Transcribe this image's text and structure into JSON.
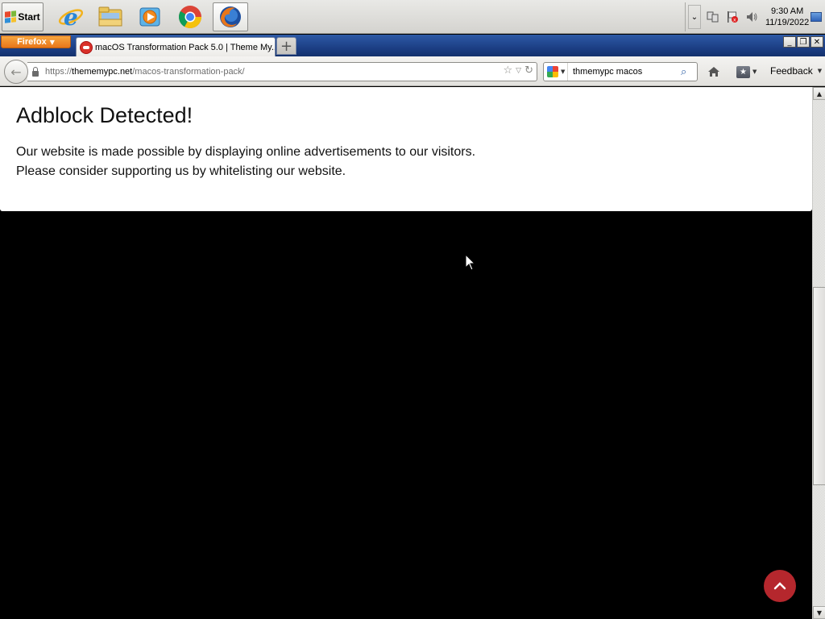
{
  "taskbar": {
    "start_label": "Start",
    "quick_launch": [
      {
        "name": "internet-explorer-icon"
      },
      {
        "name": "windows-explorer-icon"
      },
      {
        "name": "media-player-icon"
      },
      {
        "name": "chrome-icon"
      },
      {
        "name": "firefox-icon",
        "active": true
      }
    ],
    "clock": {
      "time": "9:30 AM",
      "date": "11/19/2022"
    }
  },
  "browser": {
    "menu_label": "Firefox",
    "tab_title": "macOS Transformation Pack 5.0 | Theme My...",
    "new_tab_symbol": "+",
    "url": {
      "protocol": "https://",
      "host": "thememypc.net",
      "path": "/macos-transformation-pack/"
    },
    "search": {
      "engine": "Google",
      "query": "thmemypc macos"
    },
    "feedback_label": "Feedback"
  },
  "page": {
    "adblock_title": "Adblock Detected!",
    "adblock_line1": "Our website is made possible by displaying online advertisements to our visitors.",
    "adblock_line2": "Please consider supporting us by whitelisting our website.",
    "background_color": "#000000",
    "scroll_top_color": "#b5272d"
  }
}
